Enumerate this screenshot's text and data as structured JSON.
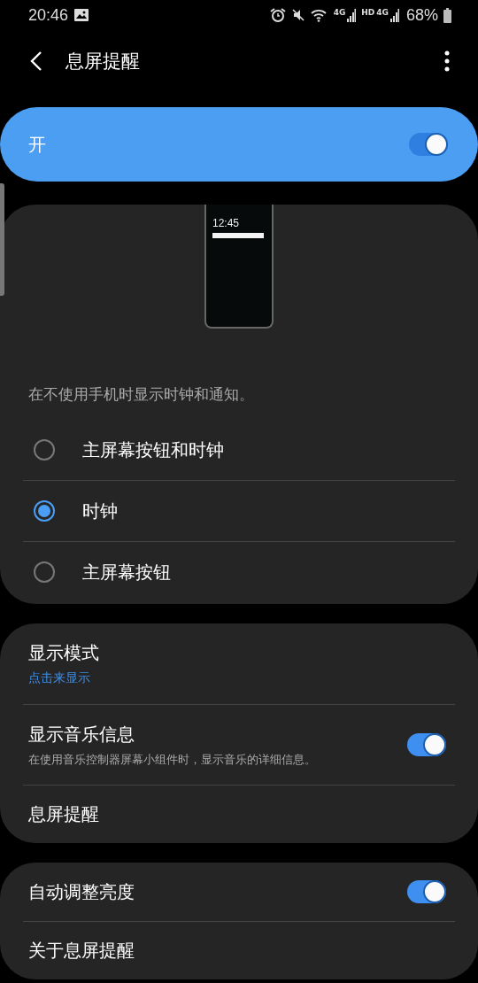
{
  "status_bar": {
    "time": "20:46",
    "network_labels": [
      "4G",
      "HD",
      "4G"
    ],
    "battery": "68%"
  },
  "header": {
    "title": "息屏提醒"
  },
  "master_switch": {
    "label": "开",
    "on": true
  },
  "preview": {
    "clock": "12:45"
  },
  "description": "在不使用手机时显示时钟和通知。",
  "options": [
    {
      "label": "主屏幕按钮和时钟",
      "selected": false
    },
    {
      "label": "时钟",
      "selected": true
    },
    {
      "label": "主屏幕按钮",
      "selected": false
    }
  ],
  "groups": [
    {
      "items": [
        {
          "kind": "link",
          "title": "显示模式",
          "subtitle": "点击来显示"
        },
        {
          "kind": "toggle",
          "title": "显示音乐信息",
          "subtitle": "在使用音乐控制器屏幕小组件时，显示音乐的详细信息。",
          "on": true
        },
        {
          "kind": "plain",
          "title": "息屏提醒"
        }
      ]
    },
    {
      "items": [
        {
          "kind": "toggle",
          "title": "自动调整亮度",
          "on": true
        },
        {
          "kind": "plain",
          "title": "关于息屏提醒"
        }
      ]
    }
  ]
}
